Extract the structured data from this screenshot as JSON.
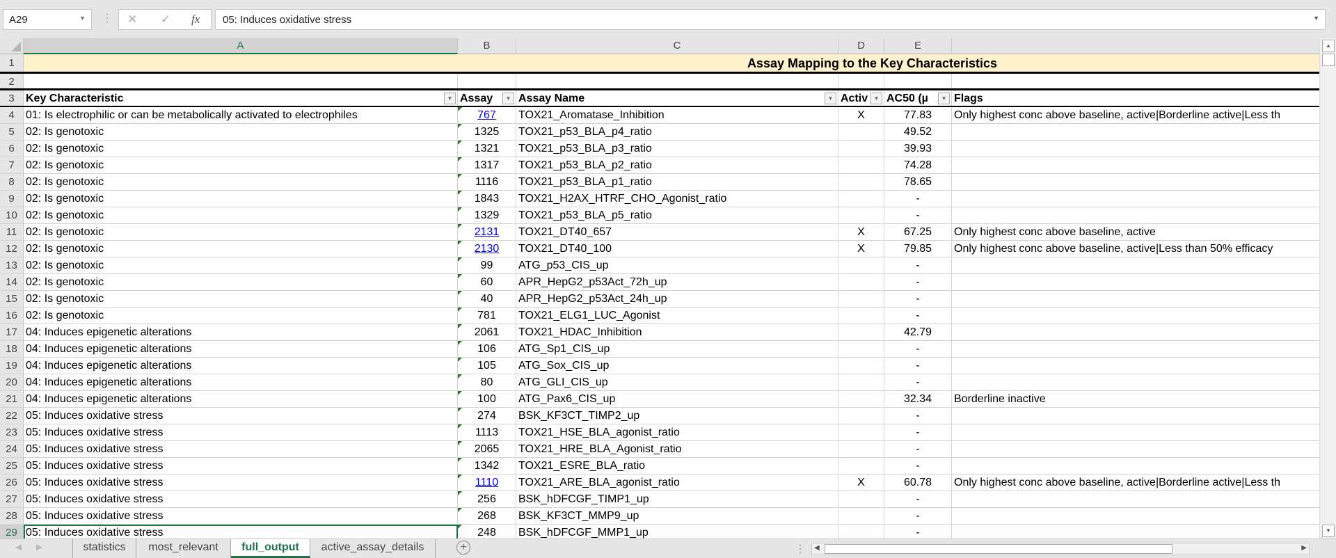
{
  "formula_bar": {
    "name_box": "A29",
    "formula": "05: Induces oxidative stress",
    "cancel": "✕",
    "enter": "✓",
    "fx": "fx"
  },
  "columns": [
    "A",
    "B",
    "C",
    "D",
    "E"
  ],
  "title": "Assay Mapping to the Key Characteristics",
  "headers": {
    "a": "Key Characteristic",
    "b": "Assay",
    "c": "Assay Name",
    "d": "Activ",
    "e": "AC50 (µ",
    "f": "Flags"
  },
  "selected_cell": "A29",
  "rows": [
    {
      "n": 4,
      "a": "01: Is electrophilic or can be metabolically activated to electrophiles",
      "b": "767",
      "link": true,
      "c": "TOX21_Aromatase_Inhibition",
      "d": "X",
      "e": "77.83",
      "f": "Only highest conc above baseline, active|Borderline active|Less th"
    },
    {
      "n": 5,
      "a": "02: Is genotoxic",
      "b": "1325",
      "c": "TOX21_p53_BLA_p4_ratio",
      "d": "",
      "e": "49.52",
      "f": ""
    },
    {
      "n": 6,
      "a": "02: Is genotoxic",
      "b": "1321",
      "c": "TOX21_p53_BLA_p3_ratio",
      "d": "",
      "e": "39.93",
      "f": ""
    },
    {
      "n": 7,
      "a": "02: Is genotoxic",
      "b": "1317",
      "c": "TOX21_p53_BLA_p2_ratio",
      "d": "",
      "e": "74.28",
      "f": ""
    },
    {
      "n": 8,
      "a": "02: Is genotoxic",
      "b": "1116",
      "c": "TOX21_p53_BLA_p1_ratio",
      "d": "",
      "e": "78.65",
      "f": ""
    },
    {
      "n": 9,
      "a": "02: Is genotoxic",
      "b": "1843",
      "c": "TOX21_H2AX_HTRF_CHO_Agonist_ratio",
      "d": "",
      "e": "-",
      "f": ""
    },
    {
      "n": 10,
      "a": "02: Is genotoxic",
      "b": "1329",
      "c": "TOX21_p53_BLA_p5_ratio",
      "d": "",
      "e": "-",
      "f": ""
    },
    {
      "n": 11,
      "a": "02: Is genotoxic",
      "b": "2131",
      "link": true,
      "c": "TOX21_DT40_657",
      "d": "X",
      "e": "67.25",
      "f": "Only highest conc above baseline, active"
    },
    {
      "n": 12,
      "a": "02: Is genotoxic",
      "b": "2130",
      "link": true,
      "c": "TOX21_DT40_100",
      "d": "X",
      "e": "79.85",
      "f": "Only highest conc above baseline, active|Less than 50% efficacy"
    },
    {
      "n": 13,
      "a": "02: Is genotoxic",
      "b": "99",
      "c": "ATG_p53_CIS_up",
      "d": "",
      "e": "-",
      "f": ""
    },
    {
      "n": 14,
      "a": "02: Is genotoxic",
      "b": "60",
      "c": "APR_HepG2_p53Act_72h_up",
      "d": "",
      "e": "-",
      "f": ""
    },
    {
      "n": 15,
      "a": "02: Is genotoxic",
      "b": "40",
      "c": "APR_HepG2_p53Act_24h_up",
      "d": "",
      "e": "-",
      "f": ""
    },
    {
      "n": 16,
      "a": "02: Is genotoxic",
      "b": "781",
      "c": "TOX21_ELG1_LUC_Agonist",
      "d": "",
      "e": "-",
      "f": ""
    },
    {
      "n": 17,
      "a": "04: Induces epigenetic alterations",
      "b": "2061",
      "c": "TOX21_HDAC_Inhibition",
      "d": "",
      "e": "42.79",
      "f": ""
    },
    {
      "n": 18,
      "a": "04: Induces epigenetic alterations",
      "b": "106",
      "c": "ATG_Sp1_CIS_up",
      "d": "",
      "e": "-",
      "f": ""
    },
    {
      "n": 19,
      "a": "04: Induces epigenetic alterations",
      "b": "105",
      "c": "ATG_Sox_CIS_up",
      "d": "",
      "e": "-",
      "f": ""
    },
    {
      "n": 20,
      "a": "04: Induces epigenetic alterations",
      "b": "80",
      "c": "ATG_GLI_CIS_up",
      "d": "",
      "e": "-",
      "f": ""
    },
    {
      "n": 21,
      "a": "04: Induces epigenetic alterations",
      "b": "100",
      "c": "ATG_Pax6_CIS_up",
      "d": "",
      "e": "32.34",
      "f": "Borderline inactive"
    },
    {
      "n": 22,
      "a": "05: Induces oxidative stress",
      "b": "274",
      "c": "BSK_KF3CT_TIMP2_up",
      "d": "",
      "e": "-",
      "f": ""
    },
    {
      "n": 23,
      "a": "05: Induces oxidative stress",
      "b": "1113",
      "c": "TOX21_HSE_BLA_agonist_ratio",
      "d": "",
      "e": "-",
      "f": ""
    },
    {
      "n": 24,
      "a": "05: Induces oxidative stress",
      "b": "2065",
      "c": "TOX21_HRE_BLA_Agonist_ratio",
      "d": "",
      "e": "-",
      "f": ""
    },
    {
      "n": 25,
      "a": "05: Induces oxidative stress",
      "b": "1342",
      "c": "TOX21_ESRE_BLA_ratio",
      "d": "",
      "e": "-",
      "f": ""
    },
    {
      "n": 26,
      "a": "05: Induces oxidative stress",
      "b": "1110",
      "link": true,
      "c": "TOX21_ARE_BLA_agonist_ratio",
      "d": "X",
      "e": "60.78",
      "f": "Only highest conc above baseline, active|Borderline active|Less th"
    },
    {
      "n": 27,
      "a": "05: Induces oxidative stress",
      "b": "256",
      "c": "BSK_hDFCGF_TIMP1_up",
      "d": "",
      "e": "-",
      "f": ""
    },
    {
      "n": 28,
      "a": "05: Induces oxidative stress",
      "b": "268",
      "c": "BSK_KF3CT_MMP9_up",
      "d": "",
      "e": "-",
      "f": ""
    },
    {
      "n": 29,
      "a": "05: Induces oxidative stress",
      "b": "248",
      "c": "BSK_hDFCGF_MMP1_up",
      "d": "",
      "e": "-",
      "f": ""
    }
  ],
  "sheet_tabs": [
    {
      "label": "statistics"
    },
    {
      "label": "most_relevant"
    },
    {
      "label": "full_output",
      "active": true
    },
    {
      "label": "active_assay_details"
    }
  ],
  "colors": {
    "accent": "#217346",
    "title_fill": "#fff2cc",
    "link": "#0000ee"
  }
}
